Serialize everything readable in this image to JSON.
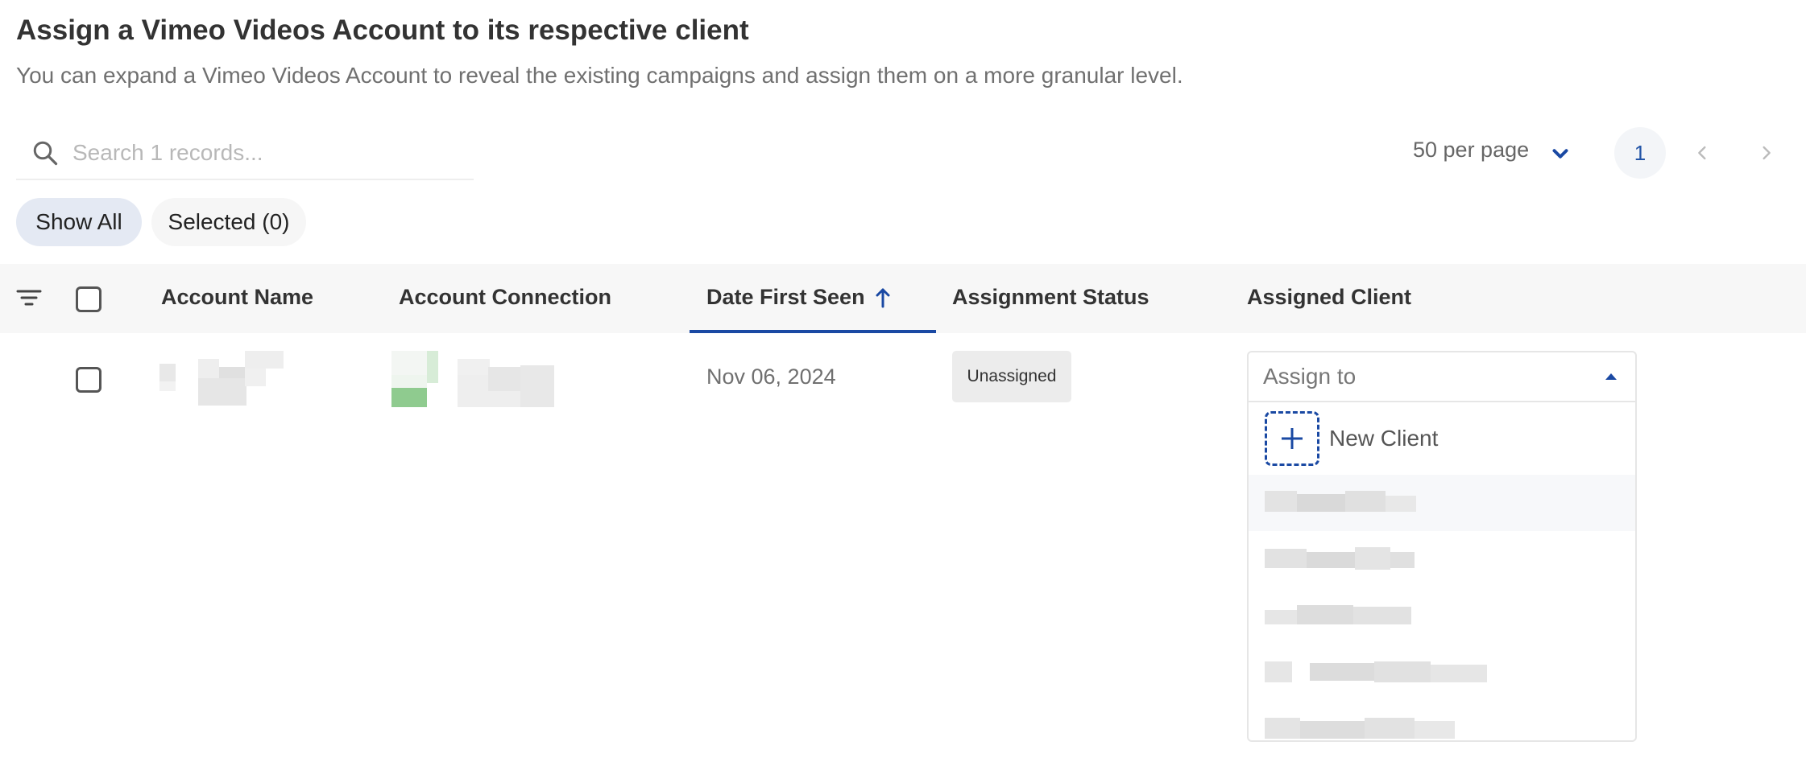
{
  "header": {
    "title": "Assign a Vimeo Videos Account to its respective client",
    "subtitle": "You can expand a Vimeo Videos Account to reveal the existing campaigns and assign them on a more granular level."
  },
  "search": {
    "placeholder": "Search 1 records...",
    "value": ""
  },
  "pagination": {
    "per_page_label": "50 per page",
    "current_page": "1"
  },
  "filters": {
    "show_all": "Show All",
    "selected": "Selected (0)"
  },
  "table": {
    "columns": [
      "Account Name",
      "Account Connection",
      "Date First Seen",
      "Assignment Status",
      "Assigned Client"
    ],
    "sorted_column": "Date First Seen",
    "sort_direction": "ascending",
    "rows": [
      {
        "date_first_seen": "Nov 06, 2024",
        "assignment_status": "Unassigned"
      }
    ]
  },
  "assign_dropdown": {
    "placeholder": "Assign to",
    "new_client_label": "New Client",
    "open": true
  },
  "colors": {
    "accent": "#1a49a3",
    "chip_active": "#e4e9f3",
    "header_bg": "#f7f7f7"
  },
  "icons": [
    "search-icon",
    "chevron-down-icon",
    "chevron-left-icon",
    "chevron-right-icon",
    "filter-icon",
    "arrow-up-icon",
    "caret-up-icon",
    "plus-icon"
  ]
}
